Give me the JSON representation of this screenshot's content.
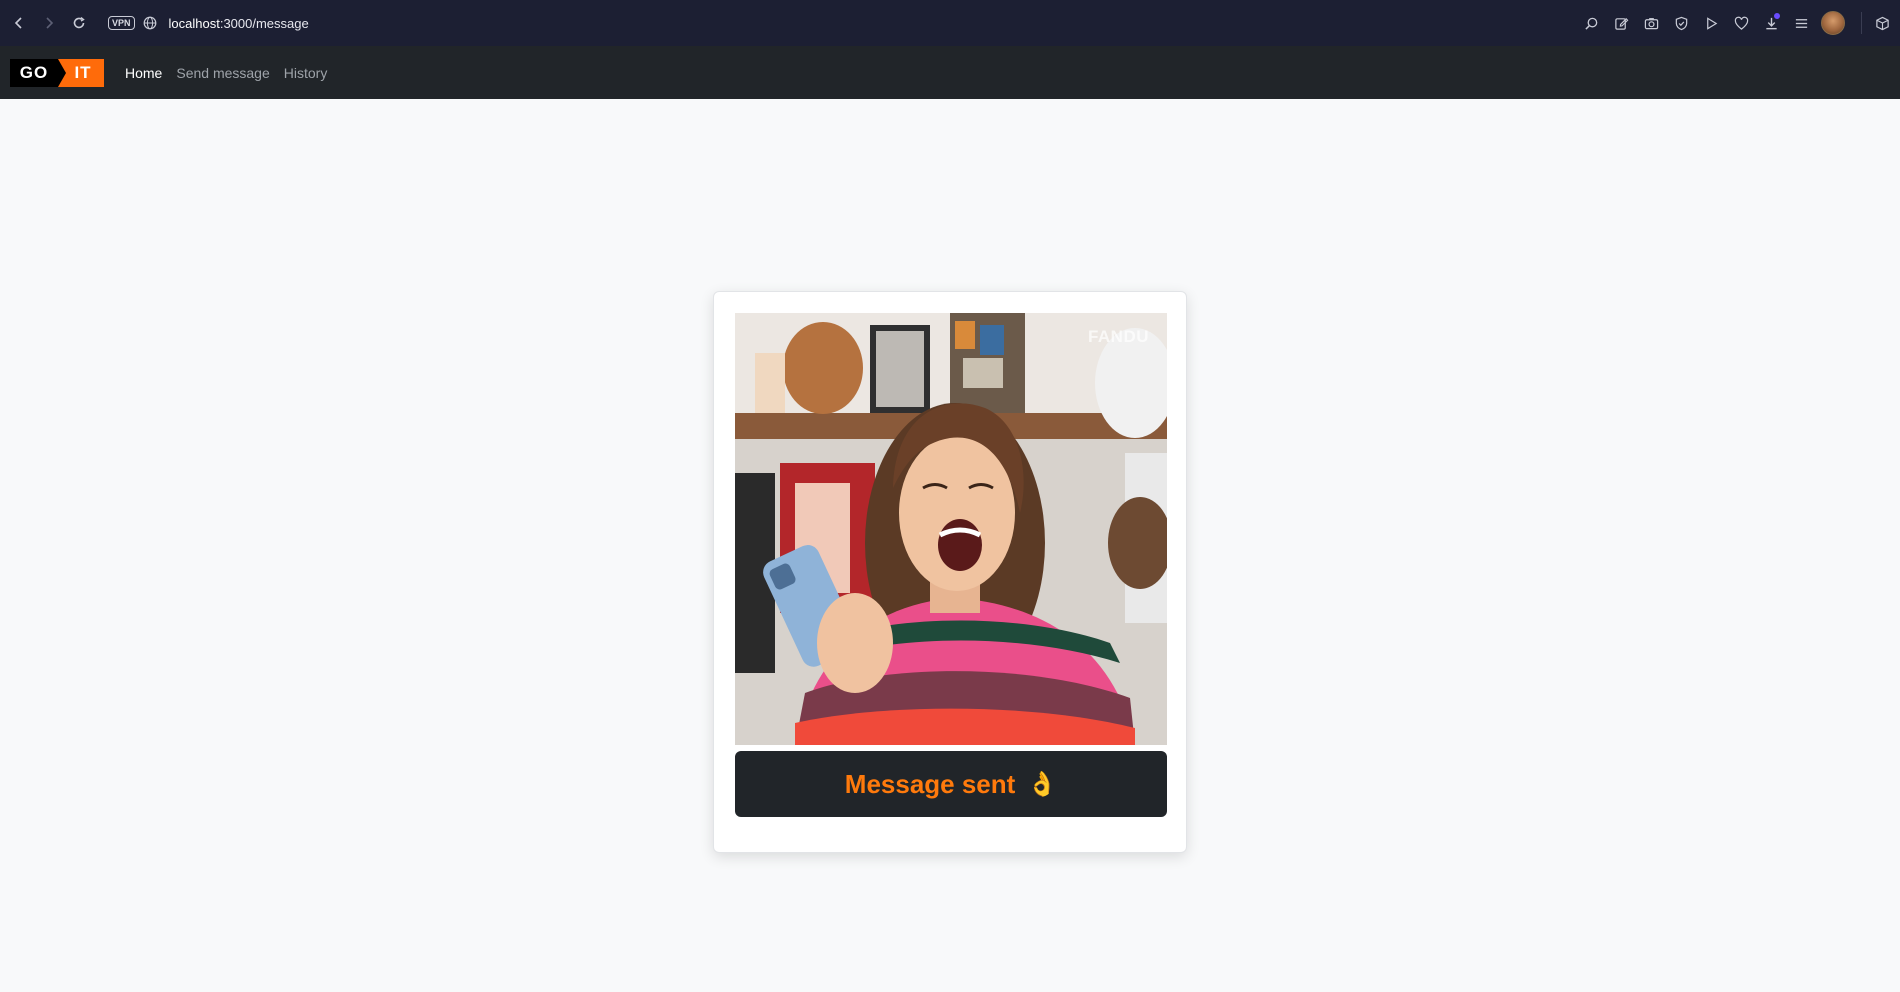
{
  "browser": {
    "vpn_label": "VPN",
    "url_host": "localhost",
    "url_path": ":3000/message"
  },
  "navbar": {
    "logo_left": "GO",
    "logo_right": "IT",
    "links": [
      {
        "label": "Home",
        "active": true
      },
      {
        "label": "Send message",
        "active": false
      },
      {
        "label": "History",
        "active": false
      }
    ]
  },
  "card": {
    "watermark": "FANDU",
    "status_label": "Message sent",
    "status_icon": "👌"
  },
  "colors": {
    "accent": "#ff7a0c",
    "navbar_bg": "#212529",
    "page_bg": "#f8f9fa"
  }
}
